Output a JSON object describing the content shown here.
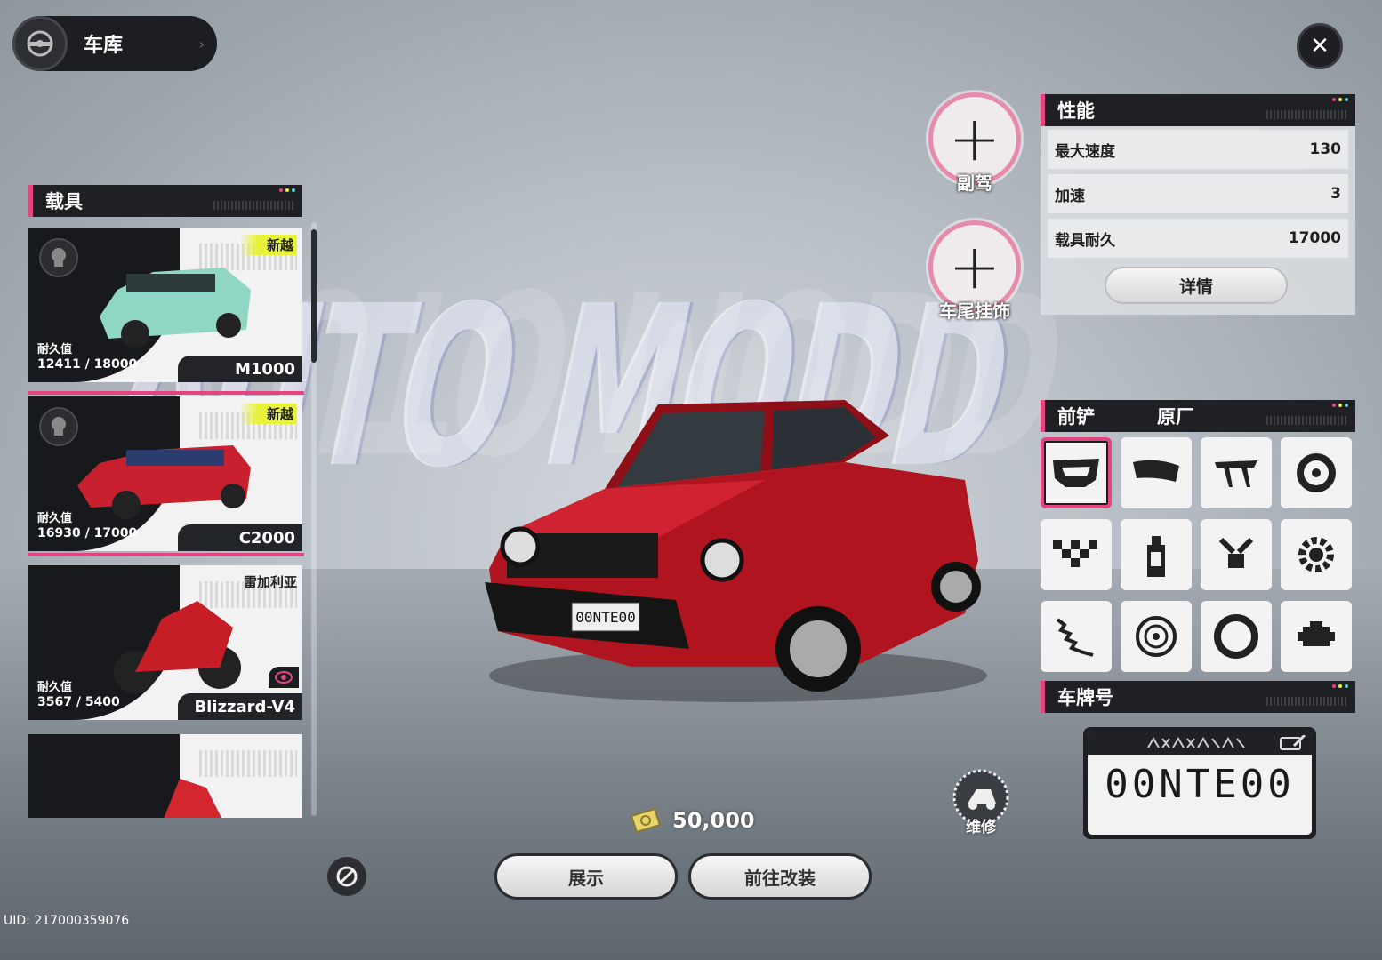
{
  "garage": {
    "title": "车库"
  },
  "vehicles_header": "载具",
  "vehicles": [
    {
      "brand": "新越",
      "durability_label": "耐久值",
      "durability": "12411 / 18000",
      "name": "M1000",
      "color": "#8fd6c4"
    },
    {
      "brand": "新越",
      "durability_label": "耐久值",
      "durability": "16930 / 17000",
      "name": "C2000",
      "color": "#c8202e"
    },
    {
      "brand": "雷加利亚",
      "durability_label": "耐久值",
      "durability": "3567 / 5400",
      "name": "Blizzard-V4",
      "color": "#c61d26"
    }
  ],
  "seat_buttons": [
    {
      "label": "副驾"
    },
    {
      "label": "车尾挂饰"
    }
  ],
  "performance": {
    "header": "性能",
    "rows": [
      {
        "label": "最大速度",
        "value": "130"
      },
      {
        "label": "加速",
        "value": "3"
      },
      {
        "label": "载具耐久",
        "value": "17000"
      }
    ],
    "detail_button": "详情"
  },
  "mod_section": {
    "part": "前铲",
    "value": "原厂"
  },
  "parts": [
    {
      "icon": "front-bumper-icon"
    },
    {
      "icon": "rear-bumper-icon"
    },
    {
      "icon": "spoiler-icon"
    },
    {
      "icon": "wheel-rim-icon"
    },
    {
      "icon": "checker-pattern-icon"
    },
    {
      "icon": "spray-paint-icon"
    },
    {
      "icon": "piston-icon"
    },
    {
      "icon": "gear-icon"
    },
    {
      "icon": "suspension-spring-icon"
    },
    {
      "icon": "brake-disc-icon"
    },
    {
      "icon": "tire-icon"
    },
    {
      "icon": "engine-icon"
    }
  ],
  "plate": {
    "header": "车牌号",
    "number": "00NTE00"
  },
  "money": "50,000",
  "buttons": {
    "show": "展示",
    "modify": "前往改装"
  },
  "repair": {
    "label": "维修"
  },
  "uid": "UID: 217000359076",
  "colors": {
    "accent": "#e5457f",
    "panel_dark": "#1f2024"
  }
}
